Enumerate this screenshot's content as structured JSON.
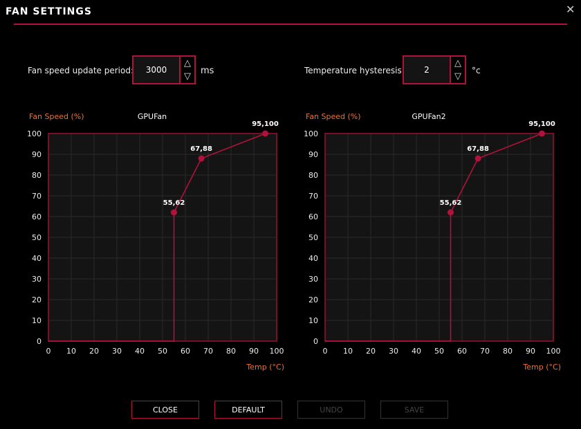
{
  "window": {
    "title": "FAN SETTINGS",
    "close_icon": "close-x-icon"
  },
  "settings": {
    "update_period": {
      "label": "Fan speed update period:",
      "value": "3000",
      "unit": "ms"
    },
    "hysteresis": {
      "label": "Temperature hysteresis:",
      "value": "2",
      "unit": "°c"
    }
  },
  "colors": {
    "accent": "#b0123c",
    "axis_label": "#e8743b",
    "plot_bg": "#141414",
    "grid": "#2a2a2a"
  },
  "buttons": {
    "close": "CLOSE",
    "default": "DEFAULT",
    "undo": "UNDO",
    "save": "SAVE"
  },
  "chart_data": [
    {
      "type": "line",
      "title": "GPUFan",
      "ylabel": "Fan Speed (%)",
      "xlabel": "Temp (°C)",
      "xlim": [
        0,
        100
      ],
      "ylim": [
        0,
        100
      ],
      "grid": true,
      "xticks": [
        0,
        10,
        20,
        30,
        40,
        50,
        60,
        70,
        80,
        90,
        100
      ],
      "yticks": [
        0,
        10,
        20,
        30,
        40,
        50,
        60,
        70,
        80,
        90,
        100
      ],
      "points": [
        {
          "x": 55,
          "y": 62,
          "label": "55,62"
        },
        {
          "x": 67,
          "y": 88,
          "label": "67,88"
        },
        {
          "x": 95,
          "y": 100,
          "label": "95,100"
        }
      ]
    },
    {
      "type": "line",
      "title": "GPUFan2",
      "ylabel": "Fan Speed (%)",
      "xlabel": "Temp (°C)",
      "xlim": [
        0,
        100
      ],
      "ylim": [
        0,
        100
      ],
      "grid": true,
      "xticks": [
        0,
        10,
        20,
        30,
        40,
        50,
        60,
        70,
        80,
        90,
        100
      ],
      "yticks": [
        0,
        10,
        20,
        30,
        40,
        50,
        60,
        70,
        80,
        90,
        100
      ],
      "points": [
        {
          "x": 55,
          "y": 62,
          "label": "55,62"
        },
        {
          "x": 67,
          "y": 88,
          "label": "67,88"
        },
        {
          "x": 95,
          "y": 100,
          "label": "95,100"
        }
      ]
    }
  ]
}
